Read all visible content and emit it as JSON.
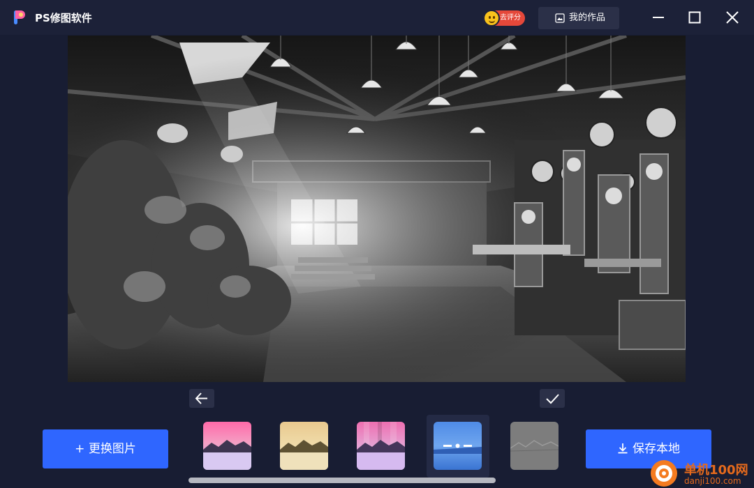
{
  "app": {
    "title": "PS修图软件"
  },
  "header": {
    "rate_label": "去评分",
    "works_label": "我的作品"
  },
  "actions": {
    "replace_label": "+ 更换图片",
    "save_label": "保存本地"
  },
  "filters": {
    "items": [
      {
        "name": "pink-mountains"
      },
      {
        "name": "golden-mountains"
      },
      {
        "name": "glitch-mountains"
      },
      {
        "name": "blue-mosaic"
      },
      {
        "name": "gray-emboss"
      }
    ],
    "selected_index": 3
  },
  "watermark": {
    "name": "单机100网",
    "url": "danji100.com"
  },
  "colors": {
    "accent": "#2f66ff",
    "background": "#181d33",
    "rate_badge": "#e5483a"
  },
  "icons": [
    "app-logo-icon",
    "smiley-icon",
    "gallery-icon",
    "minimize-icon",
    "maximize-icon",
    "close-icon",
    "arrow-left-icon",
    "checkmark-icon",
    "download-icon"
  ]
}
